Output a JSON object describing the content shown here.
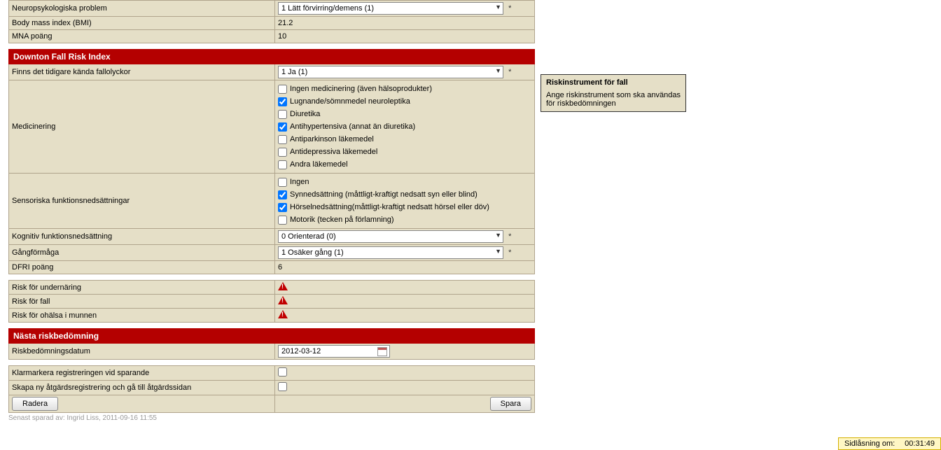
{
  "top_rows": {
    "neuro_label": "Neuropsykologiska problem",
    "neuro_value": "1 Lätt förvirring/demens (1)",
    "bmi_label": "Body mass index (BMI)",
    "bmi_value": "21.2",
    "mna_label": "MNA poäng",
    "mna_value": "10"
  },
  "downton": {
    "header": "Downton Fall Risk Index",
    "prevfall_label": "Finns det tidigare kända fallolyckor",
    "prevfall_value": "1 Ja (1)",
    "med_label": "Medicinering",
    "med_opts": [
      {
        "label": "Ingen medicinering (även hälsoprodukter)",
        "checked": false
      },
      {
        "label": "Lugnande/sömnmedel neuroleptika",
        "checked": true
      },
      {
        "label": "Diuretika",
        "checked": false
      },
      {
        "label": "Antihypertensiva (annat än diuretika)",
        "checked": true
      },
      {
        "label": "Antiparkinson läkemedel",
        "checked": false
      },
      {
        "label": "Antidepressiva läkemedel",
        "checked": false
      },
      {
        "label": "Andra läkemedel",
        "checked": false
      }
    ],
    "sens_label": "Sensoriska funktionsnedsättningar",
    "sens_opts": [
      {
        "label": "Ingen",
        "checked": false
      },
      {
        "label": "Synnedsättning (måttligt-kraftigt nedsatt syn eller blind)",
        "checked": true
      },
      {
        "label": "Hörselnedsättning(måttligt-kraftigt nedsatt hörsel eller döv)",
        "checked": true
      },
      {
        "label": "Motorik (tecken på förlamning)",
        "checked": false
      }
    ],
    "kogn_label": "Kognitiv funktionsnedsättning",
    "kogn_value": "0 Orienterad (0)",
    "gang_label": "Gångförmåga",
    "gang_value": "1 Osäker gång (1)",
    "dfri_label": "DFRI poäng",
    "dfri_value": "6"
  },
  "risks": {
    "undernaring": "Risk för undernäring",
    "fall": "Risk för fall",
    "ohalsa": "Risk för ohälsa i munnen"
  },
  "next": {
    "header": "Nästa riskbedömning",
    "date_label": "Riskbedömningsdatum",
    "date_value": "2012-03-12"
  },
  "bottom": {
    "klar_label": "Klarmarkera registreringen vid sparande",
    "skapa_label": "Skapa ny åtgärdsregistrering och gå till åtgärdssidan",
    "radera": "Radera",
    "spara": "Spara"
  },
  "saved": "Senast sparad av: Ingrid Liss, 2011-09-16 11:55",
  "tooltip": {
    "title": "Riskinstrument för fall",
    "body": "Ange riskinstrument som ska användas för riskbedömningen"
  },
  "lock": {
    "label": "Sidlåsning om:",
    "time": "00:31:49"
  }
}
